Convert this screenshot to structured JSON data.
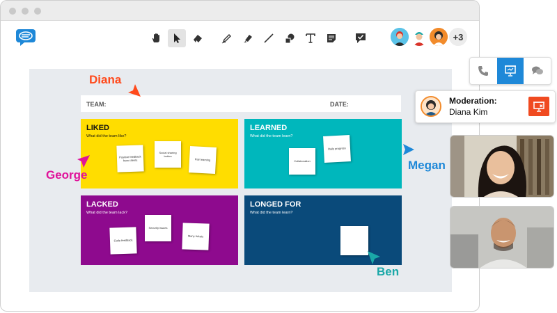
{
  "toolbar": {
    "tools": [
      "hand-tool",
      "select-tool",
      "eraser-tool",
      "pen-tool",
      "marker-tool",
      "line-tool",
      "shapes-tool",
      "text-tool",
      "sticky-note-tool",
      "feedback-tool"
    ],
    "active": "select-tool"
  },
  "participants": {
    "more": "+3"
  },
  "board": {
    "team_label": "TEAM:",
    "date_label": "DATE:",
    "liked": {
      "title": "LIKED",
      "subtitle": "What did the team like?",
      "color": "#ffdd00",
      "notes": [
        "Positive feedback from clients",
        "Social sharing button",
        "Pair learning"
      ]
    },
    "learned": {
      "title": "LEARNED",
      "subtitle": "What did the team learn?",
      "color": "#00b7bc",
      "notes": [
        "Collaboration",
        "Daily progress"
      ]
    },
    "lacked": {
      "title": "LACKED",
      "subtitle": "What did the team lack?",
      "color": "#8e0a8e",
      "notes": [
        "Code feedback",
        "Security issues",
        "Many tickets"
      ]
    },
    "longed": {
      "title": "LONGED FOR",
      "subtitle": "What did the team learn?",
      "color": "#0a4a7a",
      "notes": [
        ""
      ]
    }
  },
  "cursors": {
    "diana": {
      "name": "Diana",
      "color": "#ff4a1c"
    },
    "george": {
      "name": "George",
      "color": "#e0139a"
    },
    "megan": {
      "name": "Megan",
      "color": "#1e88d8"
    },
    "ben": {
      "name": "Ben",
      "color": "#1aa8a8"
    }
  },
  "moderation": {
    "label": "Moderation:",
    "name": "Diana Kim"
  }
}
